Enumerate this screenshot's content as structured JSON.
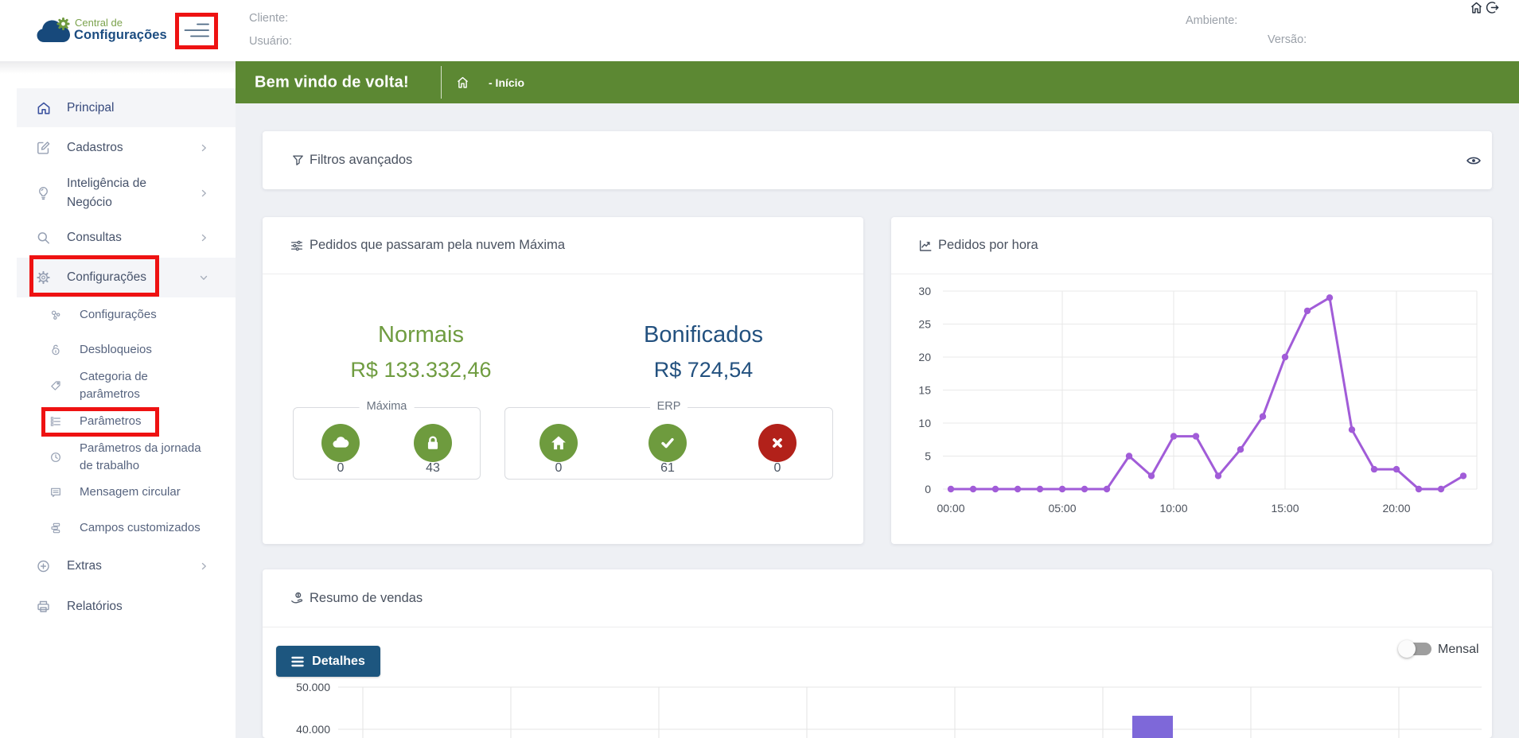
{
  "header": {
    "logo": {
      "line1": "Central de",
      "line2": "Configurações"
    },
    "fields": {
      "cliente": "Cliente:",
      "usuario": "Usuário:",
      "ambiente": "Ambiente:",
      "versao": "Versão:"
    }
  },
  "welcome_bar": {
    "title": "Bem vindo de volta!",
    "breadcrumb": "- Início"
  },
  "sidebar": {
    "items": [
      {
        "label": "Principal",
        "icon": "home"
      },
      {
        "label": "Cadastros",
        "icon": "edit-square"
      },
      {
        "label": "Inteligência de Negócio",
        "icon": "lightbulb"
      },
      {
        "label": "Consultas",
        "icon": "magnifier"
      },
      {
        "label": "Configurações",
        "icon": "gear"
      },
      {
        "label": "Configurações",
        "icon": "nodes"
      },
      {
        "label": "Desbloqueios",
        "icon": "unlock"
      },
      {
        "label": "Categoria de parâmetros",
        "icon": "tag"
      },
      {
        "label": "Parâmetros",
        "icon": "list"
      },
      {
        "label": "Parâmetros da jornada de trabalho",
        "icon": "clock"
      },
      {
        "label": "Mensagem circular",
        "icon": "message"
      },
      {
        "label": "Campos customizados",
        "icon": "stack"
      },
      {
        "label": "Extras",
        "icon": "plus-circle"
      },
      {
        "label": "Relatórios",
        "icon": "printer"
      }
    ]
  },
  "filters_card": {
    "title": "Filtros avançados"
  },
  "orders_card": {
    "title": "Pedidos que passaram pela nuvem Máxima",
    "normais": {
      "label": "Normais",
      "value": "R$ 133.332,46"
    },
    "bonificados": {
      "label": "Bonificados",
      "value": "R$ 724,54"
    },
    "maxima_group": {
      "legend": "Máxima",
      "counters": [
        {
          "icon": "cloud",
          "count": "0"
        },
        {
          "icon": "lock",
          "count": "43"
        }
      ]
    },
    "erp_group": {
      "legend": "ERP",
      "counters": [
        {
          "icon": "home",
          "count": "0"
        },
        {
          "icon": "check",
          "count": "61"
        },
        {
          "icon": "cross",
          "count": "0"
        }
      ]
    }
  },
  "hourly_card": {
    "title": "Pedidos por hora"
  },
  "sales_card": {
    "title": "Resumo de vendas",
    "details_button": "Detalhes",
    "toggle_label": "Mensal"
  },
  "colors": {
    "welcome_bar_green": "#5c8833",
    "annotation_red": "#ee1212",
    "normais_green": "#6f9c40",
    "bonificados_blue": "#23517f",
    "circle_green": "#6e9b3e",
    "circle_red": "#b2211a",
    "line_purple": "#a15cd8",
    "bar_purple": "#7e68d9",
    "details_button_blue": "#1d567f"
  },
  "chart_data": [
    {
      "id": "pedidos_por_hora",
      "type": "line",
      "title": "Pedidos por hora",
      "categories": [
        "00:00",
        "01:00",
        "02:00",
        "03:00",
        "04:00",
        "05:00",
        "06:00",
        "07:00",
        "08:00",
        "09:00",
        "10:00",
        "11:00",
        "12:00",
        "13:00",
        "14:00",
        "15:00",
        "16:00",
        "17:00",
        "18:00",
        "19:00",
        "20:00",
        "21:00",
        "22:00",
        "23:00"
      ],
      "values": [
        0,
        0,
        0,
        0,
        0,
        0,
        0,
        0,
        5,
        2,
        8,
        8,
        2,
        6,
        11,
        20,
        27,
        29,
        9,
        3,
        3,
        0,
        0,
        2
      ],
      "x_tick_labels": [
        "00:00",
        "05:00",
        "10:00",
        "15:00",
        "20:00"
      ],
      "y_ticks": [
        0,
        5,
        10,
        15,
        20,
        25,
        30
      ],
      "ylim": [
        0,
        30
      ],
      "grid": true,
      "legend": "none",
      "line_color": "#a15cd8"
    },
    {
      "id": "resumo_de_vendas",
      "type": "bar",
      "title": "Resumo de vendas",
      "y_tick_labels": [
        "50.000",
        "40.000"
      ],
      "y_tick_values": [
        50000,
        40000
      ],
      "visible_bars": [
        {
          "value": 43200
        }
      ],
      "grid": true,
      "bar_color": "#7e68d9",
      "note": "chart cut off at bottom of viewport"
    }
  ]
}
